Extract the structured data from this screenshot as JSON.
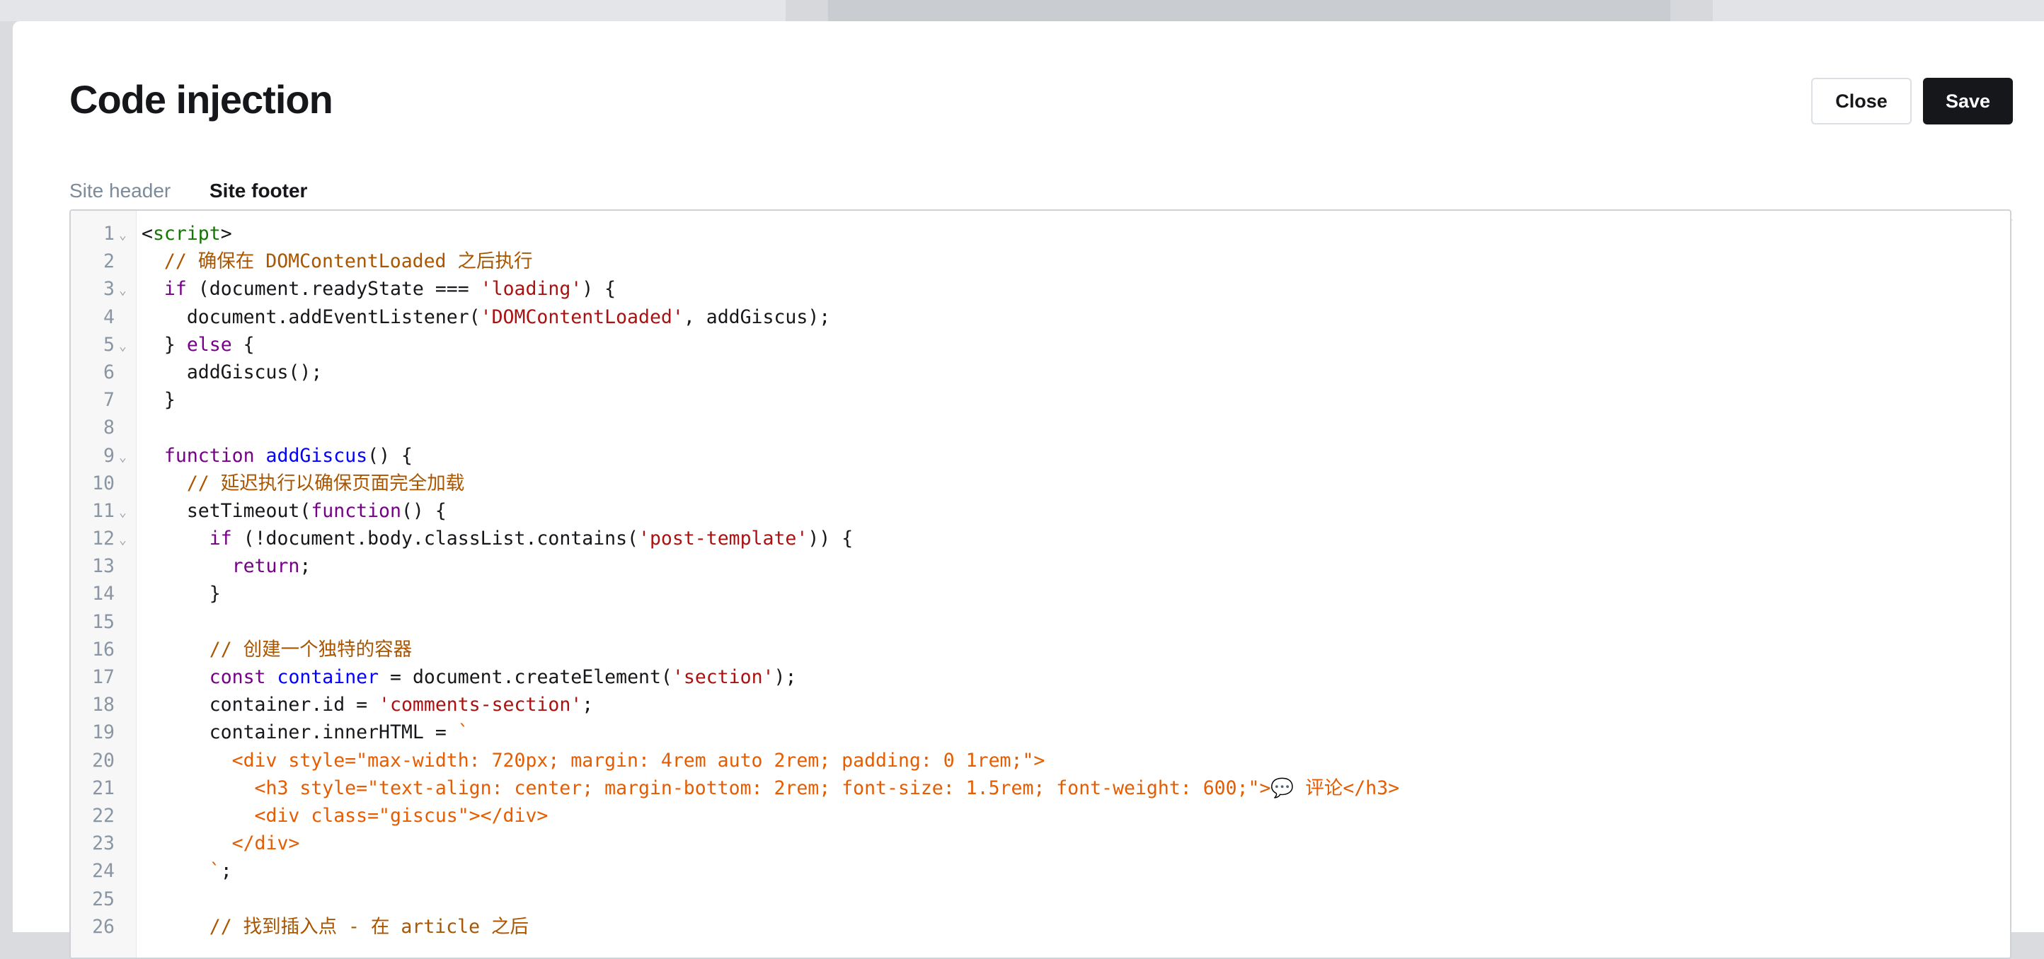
{
  "modal": {
    "title": "Code injection",
    "close_label": "Close",
    "save_label": "Save"
  },
  "tabs": [
    {
      "label": "Site header",
      "active": false
    },
    {
      "label": "Site footer",
      "active": true
    }
  ],
  "editor": {
    "lines": [
      {
        "n": "1",
        "fold": true,
        "tokens": [
          {
            "t": "<"
          },
          {
            "c": "tag",
            "t": "script"
          },
          {
            "t": ">"
          }
        ]
      },
      {
        "n": "2",
        "tokens": [
          {
            "t": "  "
          },
          {
            "c": "cm",
            "t": "// 确保在 DOMContentLoaded 之后执行"
          }
        ]
      },
      {
        "n": "3",
        "fold": true,
        "tokens": [
          {
            "t": "  "
          },
          {
            "c": "kw",
            "t": "if"
          },
          {
            "t": " (document.readyState === "
          },
          {
            "c": "str",
            "t": "'loading'"
          },
          {
            "t": ") {"
          }
        ]
      },
      {
        "n": "4",
        "tokens": [
          {
            "t": "    document.addEventListener("
          },
          {
            "c": "str",
            "t": "'DOMContentLoaded'"
          },
          {
            "t": ", addGiscus);"
          }
        ]
      },
      {
        "n": "5",
        "fold": true,
        "tokens": [
          {
            "t": "  } "
          },
          {
            "c": "kw",
            "t": "else"
          },
          {
            "t": " {"
          }
        ]
      },
      {
        "n": "6",
        "tokens": [
          {
            "t": "    addGiscus();"
          }
        ]
      },
      {
        "n": "7",
        "tokens": [
          {
            "t": "  }"
          }
        ]
      },
      {
        "n": "8",
        "tokens": []
      },
      {
        "n": "9",
        "fold": true,
        "tokens": [
          {
            "t": "  "
          },
          {
            "c": "kw",
            "t": "function"
          },
          {
            "t": " "
          },
          {
            "c": "def",
            "t": "addGiscus"
          },
          {
            "t": "() {"
          }
        ]
      },
      {
        "n": "10",
        "tokens": [
          {
            "t": "    "
          },
          {
            "c": "cm",
            "t": "// 延迟执行以确保页面完全加载"
          }
        ]
      },
      {
        "n": "11",
        "fold": true,
        "tokens": [
          {
            "t": "    setTimeout("
          },
          {
            "c": "kw",
            "t": "function"
          },
          {
            "t": "() {"
          }
        ]
      },
      {
        "n": "12",
        "fold": true,
        "tokens": [
          {
            "t": "      "
          },
          {
            "c": "kw",
            "t": "if"
          },
          {
            "t": " (!document.body.classList.contains("
          },
          {
            "c": "str",
            "t": "'post-template'"
          },
          {
            "t": ")) {"
          }
        ]
      },
      {
        "n": "13",
        "tokens": [
          {
            "t": "        "
          },
          {
            "c": "kw",
            "t": "return"
          },
          {
            "t": ";"
          }
        ]
      },
      {
        "n": "14",
        "tokens": [
          {
            "t": "      }"
          }
        ]
      },
      {
        "n": "15",
        "tokens": []
      },
      {
        "n": "16",
        "tokens": [
          {
            "t": "      "
          },
          {
            "c": "cm",
            "t": "// 创建一个独特的容器"
          }
        ]
      },
      {
        "n": "17",
        "tokens": [
          {
            "t": "      "
          },
          {
            "c": "kw",
            "t": "const"
          },
          {
            "t": " "
          },
          {
            "c": "def",
            "t": "container"
          },
          {
            "t": " = document.createElement("
          },
          {
            "c": "str",
            "t": "'section'"
          },
          {
            "t": ");"
          }
        ]
      },
      {
        "n": "18",
        "tokens": [
          {
            "t": "      container.id = "
          },
          {
            "c": "str",
            "t": "'comments-section'"
          },
          {
            "t": ";"
          }
        ]
      },
      {
        "n": "19",
        "tokens": [
          {
            "t": "      container.innerHTML = "
          },
          {
            "c": "tpl",
            "t": "`"
          }
        ]
      },
      {
        "n": "20",
        "tokens": [
          {
            "c": "tpl",
            "t": "        <div style=\"max-width: 720px; margin: 4rem auto 2rem; padding: 0 1rem;\">"
          }
        ]
      },
      {
        "n": "21",
        "tokens": [
          {
            "c": "tpl",
            "t": "          <h3 style=\"text-align: center; margin-bottom: 2rem; font-size: 1.5rem; font-weight: 600;\">💬 评论</h3>"
          }
        ]
      },
      {
        "n": "22",
        "tokens": [
          {
            "c": "tpl",
            "t": "          <div class=\"giscus\"></div>"
          }
        ]
      },
      {
        "n": "23",
        "tokens": [
          {
            "c": "tpl",
            "t": "        </div>"
          }
        ]
      },
      {
        "n": "24",
        "tokens": [
          {
            "c": "tpl",
            "t": "      `"
          },
          {
            "t": ";"
          }
        ]
      },
      {
        "n": "25",
        "tokens": []
      },
      {
        "n": "26",
        "tokens": [
          {
            "t": "      "
          },
          {
            "c": "cm",
            "t": "// 找到插入点 - 在 article 之后"
          }
        ]
      }
    ]
  }
}
